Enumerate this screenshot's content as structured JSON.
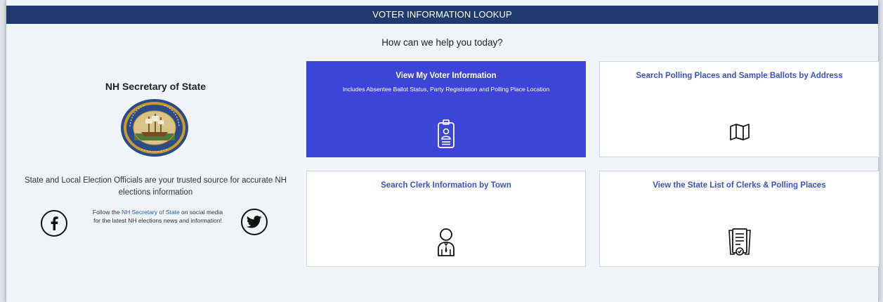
{
  "header": {
    "title": "VOTER INFORMATION LOOKUP"
  },
  "question": "How can we help you today?",
  "sidebar": {
    "org_name": "NH Secretary of State",
    "trusted_text": "State and Local Election Officials are your trusted source for accurate NH elections information",
    "follow_prefix": "Follow the ",
    "follow_link": "NH Secretary of State",
    "follow_suffix": " on social media for the latest NH elections news and information!",
    "facebook_icon": "facebook-icon",
    "twitter_icon": "twitter-icon"
  },
  "cards": [
    {
      "title": "View My Voter Information",
      "subtitle": "Includes Absentee Ballot Status, Party Registration and Polling Place Location",
      "icon": "voter-id-badge-icon"
    },
    {
      "title": "Search Polling Places and Sample Ballots by Address",
      "icon": "map-icon"
    },
    {
      "title": "Search Clerk Information by Town",
      "icon": "clerk-person-icon"
    },
    {
      "title": "View the State List of Clerks & Polling Places",
      "icon": "document-list-icon"
    }
  ],
  "colors": {
    "header_bg": "#1e3a6e",
    "primary_card_bg": "#3f44d8",
    "link_color": "#3d52c9",
    "page_bg": "#f0f4f8"
  }
}
